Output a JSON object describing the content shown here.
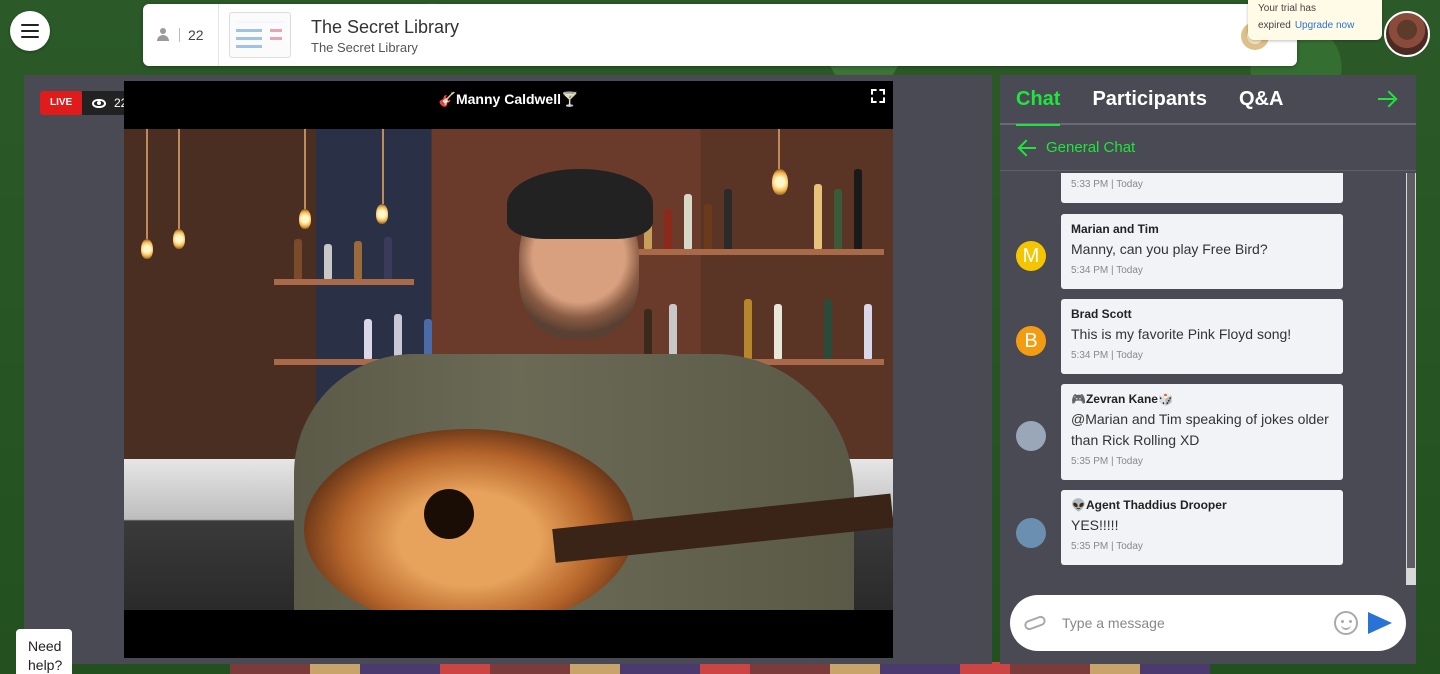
{
  "header": {
    "participant_count": "22",
    "title": "The Secret Library",
    "subtitle": "The Secret Library"
  },
  "trial": {
    "line1": "Your trial has",
    "line2": "expired",
    "upgrade_label": "Upgrade now"
  },
  "stage": {
    "live_label": "LIVE",
    "viewer_count": "22",
    "video_title": "🎸Manny Caldwell🍸"
  },
  "chat": {
    "tabs": [
      {
        "label": "Chat",
        "active": true
      },
      {
        "label": "Participants",
        "active": false
      },
      {
        "label": "Q&A",
        "active": false
      }
    ],
    "channel": "General Chat",
    "messages": [
      {
        "author": "",
        "text": "",
        "time": "5:33 PM | Today",
        "avatar_letter": "",
        "avatar_color": ""
      },
      {
        "author": "Marian and Tim",
        "text": "Manny, can you play Free Bird?",
        "time": "5:34 PM | Today",
        "avatar_letter": "M",
        "avatar_color": "#f4c500"
      },
      {
        "author": "Brad Scott",
        "text": "This is my favorite Pink Floyd song!",
        "time": "5:34 PM | Today",
        "avatar_letter": "B",
        "avatar_color": "#f39c12"
      },
      {
        "author": "🎮Zevran Kane🎲",
        "text": "@Marian and Tim speaking of jokes older than Rick Rolling XD",
        "time": "5:35 PM | Today",
        "avatar_letter": "",
        "avatar_color": "#9aa7b8"
      },
      {
        "author": "👽Agent Thaddius Drooper",
        "text": "YES!!!!!",
        "time": "5:35 PM | Today",
        "avatar_letter": "",
        "avatar_color": "#6a8fb0"
      }
    ],
    "composer_placeholder": "Type a message"
  },
  "help": {
    "line1": "Need",
    "line2": "help?"
  },
  "colors": {
    "accent_green": "#1fe63a",
    "live_red": "#e01b1b",
    "send_blue": "#2a73d6",
    "panel_bg": "#4a4a54"
  }
}
